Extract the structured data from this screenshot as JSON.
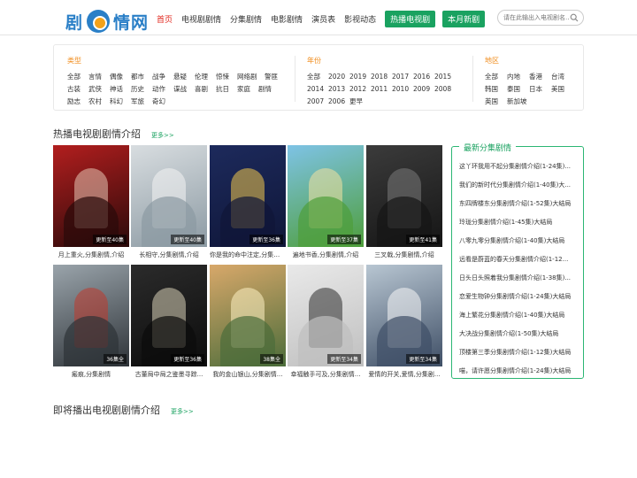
{
  "header": {
    "logo_left": "剧",
    "logo_right": "情网",
    "nav": [
      {
        "label": "首页",
        "active": true
      },
      {
        "label": "电视剧剧情"
      },
      {
        "label": "分集剧情"
      },
      {
        "label": "电影剧情"
      },
      {
        "label": "演员表"
      },
      {
        "label": "影视动态"
      }
    ],
    "tag_buttons": [
      "热播电视剧",
      "本月新剧"
    ],
    "search_placeholder": "请在此输出入电视剧名..."
  },
  "filters": {
    "genre": {
      "title": "类型",
      "items": [
        "全部",
        "言情",
        "偶像",
        "都市",
        "战争",
        "悬疑",
        "伦理",
        "惊悚",
        "网络剧",
        "警匪",
        "古装",
        "武侠",
        "神话",
        "历史",
        "动作",
        "谍战",
        "喜剧",
        "抗日",
        "家庭",
        "剧情",
        "励志",
        "农村",
        "科幻",
        "军旅",
        "奇幻"
      ]
    },
    "year": {
      "title": "年份",
      "items": [
        "全部",
        "2020",
        "2019",
        "2018",
        "2017",
        "2016",
        "2015",
        "2014",
        "2013",
        "2012",
        "2011",
        "2010",
        "2009",
        "2008",
        "2007",
        "2006",
        "更早"
      ]
    },
    "region": {
      "title": "地区",
      "items": [
        "全部",
        "内地",
        "香港",
        "台湾",
        "韩国",
        "泰国",
        "日本",
        "美国",
        "英国",
        "新加坡"
      ]
    }
  },
  "hot": {
    "title": "热播电视剧剧情介绍",
    "more": "更多>>",
    "posters": [
      {
        "caption": "月上重火,分集剧情,介绍",
        "ep": "更新至40集"
      },
      {
        "caption": "长相守,分集剧情,介绍",
        "ep": "更新至40集"
      },
      {
        "caption": "你是我的命中注定,分集剧情...",
        "ep": "更新至36集"
      },
      {
        "caption": "遍地书香,分集剧情,介绍",
        "ep": "更新至37集"
      },
      {
        "caption": "三叉戟,分集剧情,介绍",
        "ep": "更新至41集"
      },
      {
        "caption": "瘢痕,分集剧情",
        "ep": "36集全"
      },
      {
        "caption": "古董局中局之鉴墨寻踪...",
        "ep": "更新至36集"
      },
      {
        "caption": "我的金山银山,分集剧情...",
        "ep": "38集全"
      },
      {
        "caption": "幸福触手可及,分集剧情...",
        "ep": "更新至34集"
      },
      {
        "caption": "爱情的开关,爱情,分集剧...",
        "ep": "更新至34集"
      }
    ]
  },
  "sidebar": {
    "title": "最新分集剧情",
    "items": [
      "这丫环我用不起分集剧情介绍(1-24集)...",
      "我们的新时代分集剧情介绍(1-40集)大...",
      "东四牌楼东分集剧情介绍(1-52集)大结局",
      "玲珑分集剧情介绍(1-45集)大结局",
      "八零九零分集剧情介绍(1-40集)大结局",
      "远看是蔚蓝的春天分集剧情介绍(1-12...",
      "日头日头照着我分集剧情介绍(1-38集)...",
      "恋爱生物钟分集剧情介绍(1-24集)大结局",
      "海上繁花分集剧情介绍(1-40集)大结局",
      "大决战分集剧情介绍(1-50集)大结局",
      "顶楼第三季分集剧情介绍(1-12集)大结局",
      "喵，请许愿分集剧情介绍(1-24集)大结局"
    ]
  },
  "upcoming": {
    "title": "即将播出电视剧剧情介绍",
    "more": "更多>>"
  },
  "colors": {
    "accent_green": "#1aa260",
    "logo_blue": "#2a7fc7",
    "filter_orange": "#f08c1c",
    "nav_active_red": "#e1261c"
  }
}
